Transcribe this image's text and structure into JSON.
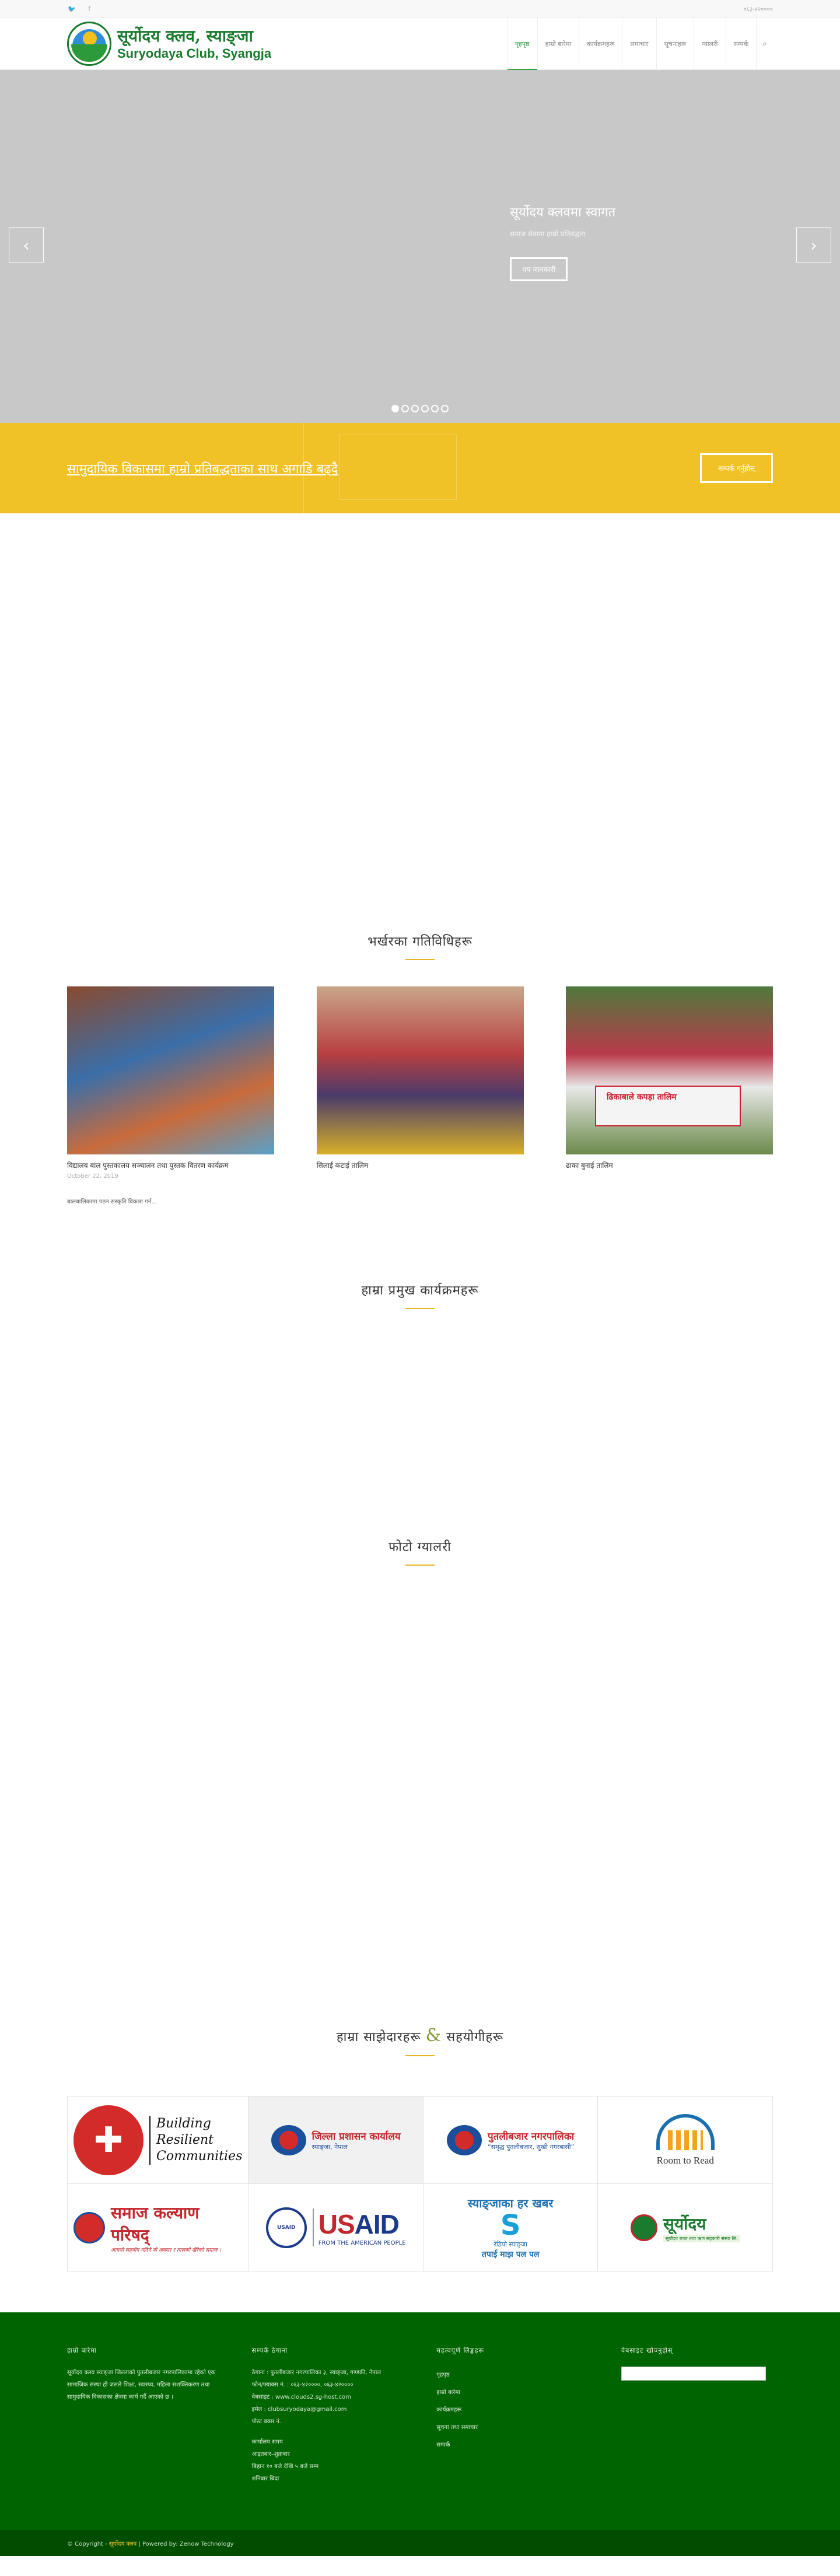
{
  "topbar": {
    "social": [
      "🐦",
      "f"
    ],
    "phone": "०६३-४२००००"
  },
  "logo": {
    "nepali_name": "सूर्योदय क्लव, स्याङ्जा",
    "english_name": "Suryodaya Club, Syangja"
  },
  "nav": {
    "items": [
      {
        "label": "गृहपृष्ठ",
        "active": true
      },
      {
        "label": "हाम्रो बारेमा"
      },
      {
        "label": "कार्यक्रमहरू"
      },
      {
        "label": "समाचार"
      },
      {
        "label": "सूचनाहरू"
      },
      {
        "label": "ग्यालरी"
      },
      {
        "label": "सम्पर्क"
      }
    ]
  },
  "slider": {
    "title": "सूर्योदय क्लवमा स्वागत",
    "subtitle": "समाज सेवामा हाम्रो प्रतिबद्धता",
    "button": "थप जानकारी",
    "slide_count": 6,
    "active_slide": 1
  },
  "promo": {
    "text": "सामुदायिक विकासमा हाम्रो प्रतिबद्धताका साथ अगाडि बढ्दै",
    "button": "सम्पर्क गर्नुहोस्"
  },
  "news": {
    "title": "भर्खरका गतिविधिहरू",
    "items": [
      {
        "headline": "विद्यालय बाल पुस्तकालय सञ्चालन तथा पुस्तक वितरण कार्यक्रम",
        "date": "October 22, 2019",
        "excerpt": "बालबालिकामा पठन संस्कृति विकास गर्न..."
      },
      {
        "headline": "सिलाई कटाई तालिम",
        "date": "",
        "excerpt": ""
      },
      {
        "headline": "ढाका बुनाई तालिम",
        "date": "",
        "excerpt": ""
      }
    ],
    "banner_text": "ढिकाबाले कपड़ा तालिम"
  },
  "sections": {
    "programs_title": "हाम्रा प्रमुख कार्यक्रमहरू",
    "gallery_title": "फोटो ग्यालरी",
    "partners_title_a": "हाम्रा साझेदारहरू",
    "partners_amp": "&",
    "partners_title_b": "सहयोगीहरू"
  },
  "partners": {
    "caritas": {
      "mark": "✚",
      "line1": "Building",
      "line2": "Resilient",
      "line3": "Communities"
    },
    "dao": {
      "main": "जिल्ला प्रशासन कार्यालय",
      "sub": "स्याङ्जा, नेपाल"
    },
    "municipality": {
      "main": "पुतलीबजार नगरपालिका",
      "sub": "“समृद्ध पुतलीबजार, सुखी नगरबासी”"
    },
    "room_to_read": {
      "text": "Room to Read"
    },
    "swc": {
      "main": "समाज कल्याण परिषद्",
      "sub": "आफ्नो सहयोग नतिने यो अवसर र त्यसको खैरेको समाज ।"
    },
    "usaid": {
      "seal": "USAID",
      "main_a": "US",
      "main_b": "AID",
      "sub": "FROM THE AMERICAN PEOPLE"
    },
    "radio": {
      "top": "स्याङ्जाका हर खबर",
      "mark": "S",
      "fm": "रेडियो स्याङ्जा",
      "bottom": "तपाई माझ पल पल"
    },
    "cooperative": {
      "main": "सूर्योदय",
      "sub": "सूर्योदय बचत तथा ऋण सहकारी संस्था लि."
    }
  },
  "footer": {
    "col1": {
      "title": "हाम्रो बारेमा",
      "text": "सूर्योदय क्लव स्याङ्जा जिल्लाको पुतलीबजार नगरपालिकामा रहेको एक सामाजिक संस्था हो जसले शिक्षा, स्वास्थ्य, महिला सशक्तिकरण तथा सामुदायिक विकासका क्षेत्रमा कार्य गर्दै आएको छ ।"
    },
    "col2": {
      "title": "सम्पर्क ठेगाना",
      "address": "ठेगाना : पुतलीबजार नगरपालिका ३, स्याङ्जा, गण्डकी, नेपाल",
      "phone": "फोन/फ्याक्स नं. : ०६३-४२००००, ०६३-४२००००",
      "website": "वेबसाइट : www.clouds2.sg-host.com",
      "email": "इमेल : clubsuryodaya@gmail.com",
      "box": "पोस्ट बक्स नं.",
      "hours_title": "कार्यालय समय",
      "hours": "आइतबार–शुक्रबार",
      "hours_time": "बिहान १० बजे देखि ५ बजे सम्म",
      "holiday": "शनिबार बिदा"
    },
    "col3": {
      "title": "महत्वपूर्ण लिङ्कहरू",
      "links": [
        "गृहपृष्ठ",
        "हाम्रो बारेमा",
        "कार्यक्रमहरू",
        "सूचना तथा समाचार",
        "सम्पर्क"
      ]
    },
    "col4": {
      "title": "वेबसाइट खोज्नुहोस्"
    }
  },
  "bottom": {
    "prefix": "© Copyright - ",
    "org": "सूर्योदय क्लव",
    "suffix": " | Powered by: Zenow Technology"
  }
}
